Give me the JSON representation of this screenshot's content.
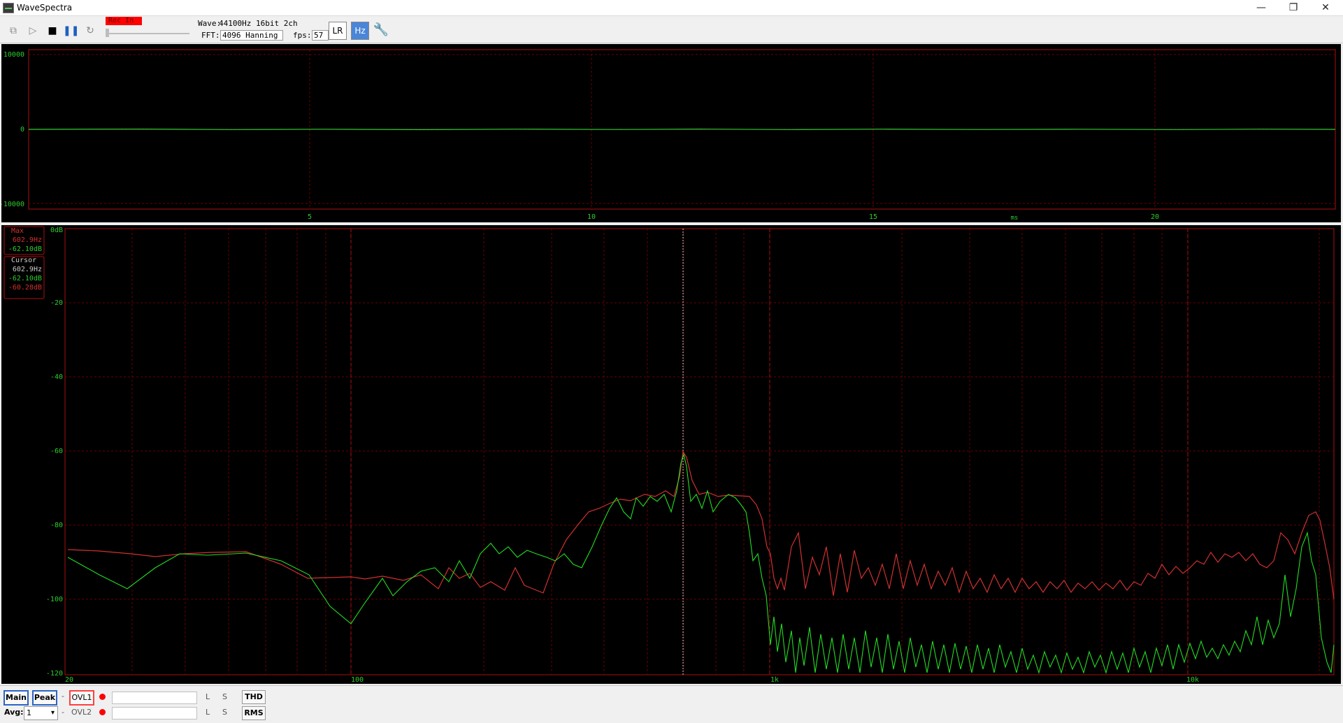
{
  "window": {
    "title": "WaveSpectra",
    "min_label": "—",
    "max_label": "❐",
    "close_label": "✕"
  },
  "toolbar": {
    "rec_label": "Rec In",
    "wave_label": "Wave:",
    "wave_value": "44100Hz 16bit 2ch",
    "fft_label": "FFT:",
    "fft_value": "4096 Hanning",
    "fps_label": "fps:",
    "fps_value": "57"
  },
  "icons": {
    "lr": "LR",
    "hz": "Hz",
    "tools": "wrench"
  },
  "wave_chart": {
    "y_ticks": [
      "10000",
      "0",
      "-10000"
    ],
    "x_ticks": [
      "5",
      "10",
      "15",
      "20"
    ],
    "unit": "ms"
  },
  "spectrum": {
    "y_ticks": [
      "0dB",
      "-20",
      "-40",
      "-60",
      "-80",
      "-100",
      "-120"
    ],
    "x_ticks": [
      "20",
      "100",
      "1k",
      "10k"
    ],
    "max_box": {
      "label": "Max",
      "freq": "602.9Hz",
      "db": "-62.10dB"
    },
    "cursor_box": {
      "label": "Cursor",
      "freq": "602.9Hz",
      "db_green": "-62.10dB",
      "db_red": "-60.28dB"
    }
  },
  "bottom": {
    "main": "Main",
    "peak": "Peak",
    "dash1": "-",
    "ovl1": "OVL1",
    "ovl2": "OVL2",
    "dash2": "-",
    "l1": "L",
    "s1": "S",
    "l2": "L",
    "s2": "S",
    "thd": "THD",
    "rms": "RMS",
    "avg_label": "Avg:",
    "avg_value": "1"
  },
  "colors": {
    "wave_green": "#33cc33",
    "spectrum_red": "#d03030",
    "spectrum_green": "#22dd22",
    "grid_red": "#8a0000"
  }
}
